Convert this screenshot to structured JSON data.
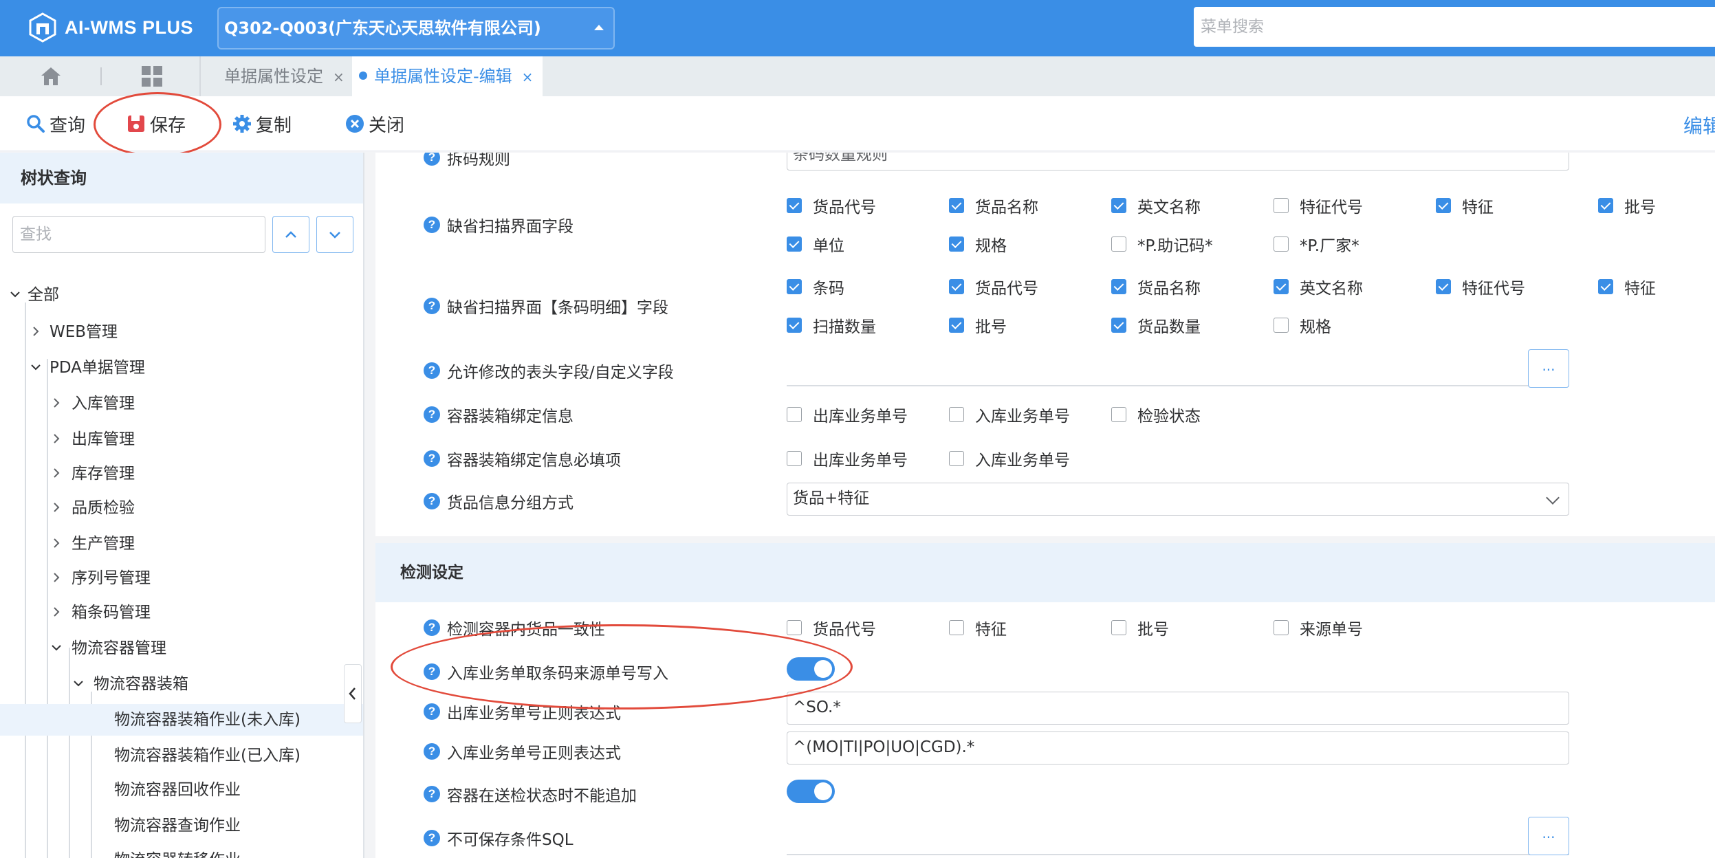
{
  "app": {
    "name": "AI-WMS PLUS",
    "tenant": "Q302-Q003(广东天心天思软件有限公司)",
    "menu_search_placeholder": "菜单搜索"
  },
  "tabs": [
    {
      "label": "单据属性设定",
      "close": "×"
    },
    {
      "label": "单据属性设定-编辑",
      "close": "×"
    }
  ],
  "toolbar": {
    "query": "查询",
    "save": "保存",
    "copy": "复制",
    "close": "关闭",
    "edit": "编辑"
  },
  "sidebar": {
    "title": "树状查询",
    "search_placeholder": "查找",
    "tree": [
      "全部",
      "WEB管理",
      "PDA单据管理",
      "入库管理",
      "出库管理",
      "库存管理",
      "品质检验",
      "生产管理",
      "序列号管理",
      "箱条码管理",
      "物流容器管理",
      "物流容器装箱",
      "物流容器装箱作业(未入库)",
      "物流容器装箱作业(已入库)",
      "物流容器回收作业",
      "物流容器查询作业",
      "物流容器转移作业"
    ]
  },
  "form": {
    "partial_top": {
      "label": "拆码规则",
      "value": "条码数量规则"
    },
    "default_scan_fields": {
      "label": "缺省扫描界面字段",
      "options": [
        {
          "text": "货品代号",
          "checked": true
        },
        {
          "text": "货品名称",
          "checked": true
        },
        {
          "text": "英文名称",
          "checked": true
        },
        {
          "text": "特征代号",
          "checked": false
        },
        {
          "text": "特征",
          "checked": true
        },
        {
          "text": "批号",
          "checked": true
        },
        {
          "text": "单位",
          "checked": true
        },
        {
          "text": "规格",
          "checked": true
        },
        {
          "text": "*P.助记码*",
          "checked": false
        },
        {
          "text": "*P.厂家*",
          "checked": false
        }
      ]
    },
    "default_scan_detail_fields": {
      "label": "缺省扫描界面【条码明细】字段",
      "options": [
        {
          "text": "条码",
          "checked": true
        },
        {
          "text": "货品代号",
          "checked": true
        },
        {
          "text": "货品名称",
          "checked": true
        },
        {
          "text": "英文名称",
          "checked": true
        },
        {
          "text": "特征代号",
          "checked": true
        },
        {
          "text": "特征",
          "checked": true
        },
        {
          "text": "扫描数量",
          "checked": true
        },
        {
          "text": "批号",
          "checked": true
        },
        {
          "text": "货品数量",
          "checked": true
        },
        {
          "text": "规格",
          "checked": false
        }
      ]
    },
    "editable_fields": {
      "label": "允许修改的表头字段/自定义字段",
      "button": "..."
    },
    "container_bind": {
      "label": "容器装箱绑定信息",
      "options": [
        {
          "text": "出库业务单号",
          "checked": false
        },
        {
          "text": "入库业务单号",
          "checked": false
        },
        {
          "text": "检验状态",
          "checked": false
        }
      ]
    },
    "container_bind_required": {
      "label": "容器装箱绑定信息必填项",
      "options": [
        {
          "text": "出库业务单号",
          "checked": false
        },
        {
          "text": "入库业务单号",
          "checked": false
        }
      ]
    },
    "grouping": {
      "label": "货品信息分组方式",
      "value": "货品+特征"
    }
  },
  "detect": {
    "title": "检测设定",
    "consistency": {
      "label": "检测容器内货品一致性",
      "options": [
        {
          "text": "货品代号",
          "checked": false
        },
        {
          "text": "特征",
          "checked": false
        },
        {
          "text": "批号",
          "checked": false
        },
        {
          "text": "来源单号",
          "checked": false
        }
      ]
    },
    "inbound_source": {
      "label": "入库业务单取条码来源单号写入",
      "on": true
    },
    "outbound_regex": {
      "label": "出库业务单号正则表达式",
      "value": "^SO.*"
    },
    "inbound_regex": {
      "label": "入库业务单号正则表达式",
      "value": "^(MO|TI|PO|UO|CGD).*"
    },
    "no_append": {
      "label": "容器在送检状态时不能追加",
      "on": true
    },
    "no_save_sql": {
      "label": "不可保存条件SQL",
      "button": "..."
    }
  },
  "colors": {
    "primary": "#3a8ee6",
    "annotation": "#e24a3b"
  },
  "icons": [
    "home-icon",
    "grid-icon",
    "search-icon",
    "save-icon",
    "gear-icon",
    "close-circle-icon",
    "help-icon",
    "chevron-up-icon",
    "chevron-down-icon",
    "chevron-right-icon",
    "chevron-left-icon"
  ]
}
